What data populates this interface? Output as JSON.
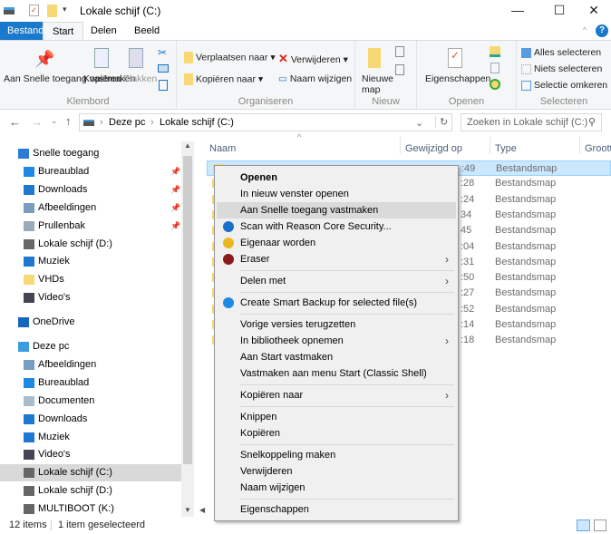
{
  "window": {
    "title": "Lokale schijf (C:)",
    "minimize": "—",
    "maximize": "☐",
    "close": "✕"
  },
  "tabs": [
    "Bestand",
    "Start",
    "Delen",
    "Beeld"
  ],
  "ribbon": {
    "klembord": {
      "label": "Klembord",
      "pin": "Aan Snelle toegang vastmaken",
      "copy": "Kopiëren",
      "paste": "Plakken"
    },
    "organiseren": {
      "label": "Organiseren",
      "move": "Verplaatsen naar",
      "copy_to": "Kopiëren naar",
      "delete": "Verwijderen",
      "rename": "Naam wijzigen"
    },
    "nieuw": {
      "label": "Nieuw",
      "new_folder": "Nieuwe map"
    },
    "openen": {
      "label": "Openen",
      "properties": "Eigenschappen"
    },
    "selecteren": {
      "label": "Selecteren",
      "all": "Alles selecteren",
      "none": "Niets selecteren",
      "invert": "Selectie omkeren"
    }
  },
  "address": {
    "crumbs": [
      "Deze pc",
      "Lokale schijf (C:)"
    ],
    "search_placeholder": "Zoeken in Lokale schijf (C:)"
  },
  "nav": [
    {
      "label": "Snelle toegang",
      "icon": "star-icon",
      "color": "#2b7ad6",
      "indent": 0
    },
    {
      "label": "Bureaublad",
      "icon": "desktop-icon",
      "color": "#1e88e5",
      "indent": 1,
      "pinned": true
    },
    {
      "label": "Downloads",
      "icon": "download-icon",
      "color": "#1e78d0",
      "indent": 1,
      "pinned": true
    },
    {
      "label": "Afbeeldingen",
      "icon": "pictures-icon",
      "color": "#7a9cc0",
      "indent": 1,
      "pinned": true
    },
    {
      "label": "Prullenbak",
      "icon": "recycle-bin-icon",
      "color": "#9ab",
      "indent": 1,
      "pinned": true
    },
    {
      "label": "Lokale schijf (D:)",
      "icon": "drive-icon",
      "color": "#666",
      "indent": 1
    },
    {
      "label": "Muziek",
      "icon": "music-icon",
      "color": "#1e78d0",
      "indent": 1
    },
    {
      "label": "VHDs",
      "icon": "folder-icon",
      "color": "#f8d775",
      "indent": 1
    },
    {
      "label": "Video's",
      "icon": "video-icon",
      "color": "#445",
      "indent": 1
    },
    {
      "label": "OneDrive",
      "icon": "cloud-icon",
      "color": "#1565c0",
      "indent": 0,
      "gap": true
    },
    {
      "label": "Deze pc",
      "icon": "computer-icon",
      "color": "#3a9de0",
      "indent": 0,
      "gap": true
    },
    {
      "label": "Afbeeldingen",
      "icon": "pictures-icon",
      "color": "#7a9cc0",
      "indent": 1
    },
    {
      "label": "Bureaublad",
      "icon": "desktop-icon",
      "color": "#1e88e5",
      "indent": 1
    },
    {
      "label": "Documenten",
      "icon": "documents-icon",
      "color": "#abc",
      "indent": 1
    },
    {
      "label": "Downloads",
      "icon": "download-icon",
      "color": "#1e78d0",
      "indent": 1
    },
    {
      "label": "Muziek",
      "icon": "music-icon",
      "color": "#1e78d0",
      "indent": 1
    },
    {
      "label": "Video's",
      "icon": "video-icon",
      "color": "#445",
      "indent": 1
    },
    {
      "label": "Lokale schijf (C:)",
      "icon": "drive-icon",
      "color": "#666",
      "indent": 1,
      "selected": true
    },
    {
      "label": "Lokale schijf (D:)",
      "icon": "drive-icon",
      "color": "#666",
      "indent": 1
    },
    {
      "label": "MULTIBOOT (K:)",
      "icon": "drive-icon",
      "color": "#666",
      "indent": 1
    }
  ],
  "columns": [
    "Naam",
    "Gewijzigd op",
    "Type",
    "Grootte"
  ],
  "rows": [
    {
      "date": ":49",
      "type": "Bestandsmap"
    },
    {
      "date": ":28",
      "type": "Bestandsmap"
    },
    {
      "date": ":24",
      "type": "Bestandsmap"
    },
    {
      "date": "34",
      "type": "Bestandsmap"
    },
    {
      "date": "45",
      "type": "Bestandsmap"
    },
    {
      "date": ":04",
      "type": "Bestandsmap"
    },
    {
      "date": ":31",
      "type": "Bestandsmap"
    },
    {
      "date": ":50",
      "type": "Bestandsmap"
    },
    {
      "date": ":27",
      "type": "Bestandsmap"
    },
    {
      "date": ":52",
      "type": "Bestandsmap"
    },
    {
      "date": ":14",
      "type": "Bestandsmap"
    },
    {
      "date": ":18",
      "type": "Bestandsmap"
    }
  ],
  "context_menu": [
    {
      "label": "Openen",
      "bold": true
    },
    {
      "label": "In nieuw venster openen"
    },
    {
      "label": "Aan Snelle toegang vastmaken",
      "highlight": true
    },
    {
      "label": "Scan with Reason Core Security...",
      "icon": "reason-core-icon",
      "color": "#1a6fc9"
    },
    {
      "label": "Eigenaar worden",
      "icon": "uac-shield-icon",
      "color": "#e8b820"
    },
    {
      "label": "Eraser",
      "icon": "eraser-icon",
      "color": "#8b1a1a",
      "submenu": true
    },
    {
      "sep": true
    },
    {
      "label": "Delen met",
      "submenu": true
    },
    {
      "sep": true
    },
    {
      "label": "Create Smart Backup for selected file(s)",
      "icon": "backup-icon",
      "color": "#1e88e5"
    },
    {
      "sep": true
    },
    {
      "label": "Vorige versies terugzetten"
    },
    {
      "label": "In bibliotheek opnemen",
      "submenu": true
    },
    {
      "label": "Aan Start vastmaken"
    },
    {
      "label": "Vastmaken aan menu Start (Classic Shell)"
    },
    {
      "sep": true
    },
    {
      "label": "Kopiëren naar",
      "submenu": true
    },
    {
      "sep": true
    },
    {
      "label": "Knippen"
    },
    {
      "label": "Kopiëren"
    },
    {
      "sep": true
    },
    {
      "label": "Snelkoppeling maken"
    },
    {
      "label": "Verwijderen"
    },
    {
      "label": "Naam wijzigen"
    },
    {
      "sep": true
    },
    {
      "label": "Eigenschappen"
    }
  ],
  "status": {
    "count": "12 items",
    "selected": "1 item geselecteerd"
  }
}
